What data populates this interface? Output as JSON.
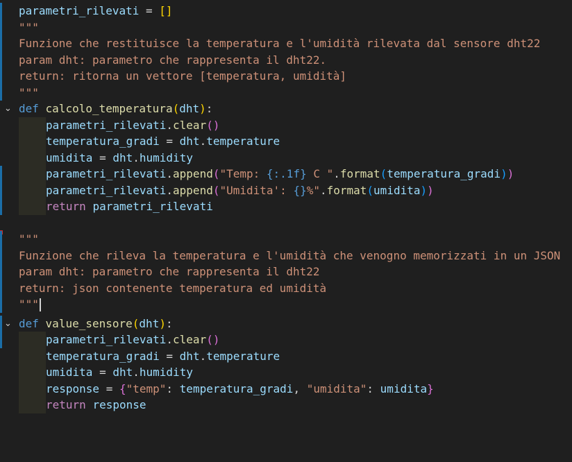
{
  "editor": {
    "lines": [
      "parametri_rilevati = []",
      "\"\"\"",
      "Funzione che restituisce la temperatura e l'umidità rilevata dal sensore dht22",
      "param dht: parametro che rappresenta il dht22.",
      "return: ritorna un vettore [temperatura, umidità]",
      "\"\"\"",
      "def calcolo_temperatura(dht):",
      "parametri_rilevati.clear()",
      "temperatura_gradi = dht.temperature",
      "umidita = dht.humidity",
      "parametri_rilevati.append(\"Temp: {:.1f} C \".format(temperatura_gradi))",
      "parametri_rilevati.append(\"Umidita': {}%\".format(umidita))",
      "return parametri_rilevati",
      "",
      "\"\"\"",
      "Funzione che rileva la temperatura e l'umidità che venogno memorizzati in un JSON",
      "param dht: parametro che rappresenta il dht22",
      "return: json contenente temperatura ed umidità",
      "\"\"\"",
      "def value_sensore(dht):",
      "parametri_rilevati.clear()",
      "temperatura_gradi = dht.temperature",
      "umidita = dht.humidity",
      "response = {\"temp\": temperatura_gradi, \"umidita\": umidita}",
      "return response"
    ],
    "fold_icon": "chevron-down-icon",
    "colors": {
      "background": "#1f1f1f",
      "variable": "#9cdcfe",
      "string": "#ce9178",
      "function": "#dcdcaa",
      "keyword": "#569cd6",
      "control": "#c586c0",
      "gutter_modified": "#1b6ea8"
    }
  }
}
